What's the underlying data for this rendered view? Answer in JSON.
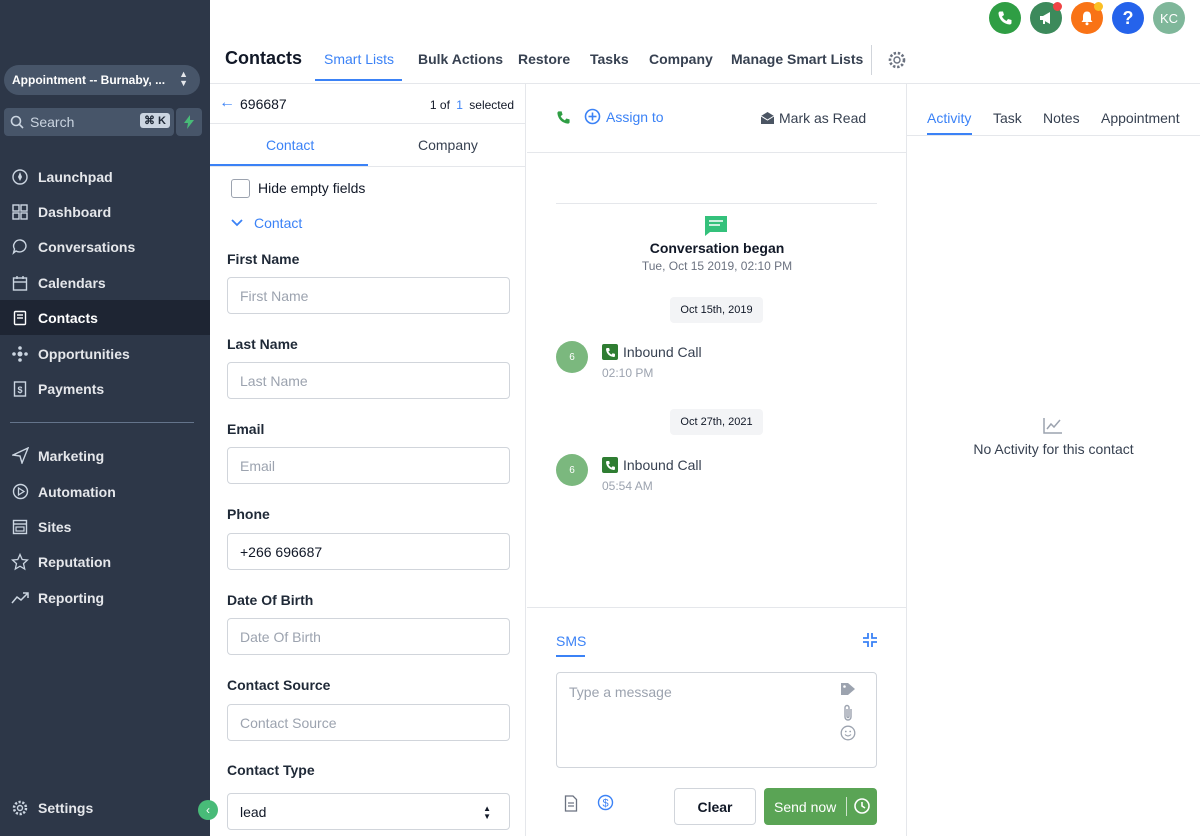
{
  "sidebar": {
    "location": "Appointment -- Burnaby, ...",
    "search_placeholder": "Search",
    "search_shortcut": "⌘ K",
    "items": [
      {
        "label": "Launchpad",
        "icon": "rocket-icon"
      },
      {
        "label": "Dashboard",
        "icon": "grid-icon"
      },
      {
        "label": "Conversations",
        "icon": "chat-icon"
      },
      {
        "label": "Calendars",
        "icon": "calendar-icon"
      },
      {
        "label": "Contacts",
        "icon": "contacts-icon",
        "active": true
      },
      {
        "label": "Opportunities",
        "icon": "opportunities-icon"
      },
      {
        "label": "Payments",
        "icon": "payments-icon"
      },
      {
        "label": "Marketing",
        "icon": "send-icon"
      },
      {
        "label": "Automation",
        "icon": "automation-icon"
      },
      {
        "label": "Sites",
        "icon": "sites-icon"
      },
      {
        "label": "Reputation",
        "icon": "star-icon"
      },
      {
        "label": "Reporting",
        "icon": "trend-icon"
      }
    ],
    "settings_label": "Settings"
  },
  "topbar": {
    "title": "Contacts",
    "tabs": [
      "Smart Lists",
      "Bulk Actions",
      "Restore",
      "Tasks",
      "Company",
      "Manage Smart Lists"
    ],
    "avatar_initials": "KC",
    "help_label": "?"
  },
  "contact": {
    "id": "696687",
    "pager_prefix": "1 of",
    "pager_count": "1",
    "pager_suffix": "selected",
    "tabs": [
      "Contact",
      "Company"
    ],
    "hide_empty_label": "Hide empty fields",
    "section_label": "Contact",
    "fields": [
      {
        "label": "First Name",
        "placeholder": "First Name",
        "value": ""
      },
      {
        "label": "Last Name",
        "placeholder": "Last Name",
        "value": ""
      },
      {
        "label": "Email",
        "placeholder": "Email",
        "value": ""
      },
      {
        "label": "Phone",
        "placeholder": "",
        "value": "+266 696687"
      },
      {
        "label": "Date Of Birth",
        "placeholder": "Date Of Birth",
        "value": ""
      },
      {
        "label": "Contact Source",
        "placeholder": "Contact Source",
        "value": ""
      },
      {
        "label": "Contact Type",
        "value": "lead"
      }
    ]
  },
  "conversation": {
    "assign_label": "Assign to",
    "mark_read_label": "Mark as Read",
    "began_label": "Conversation began",
    "began_time": "Tue, Oct 15 2019, 02:10 PM",
    "events": [
      {
        "date": "Oct 15th, 2019",
        "avatar": "6",
        "type": "Inbound Call",
        "time": "02:10 PM"
      },
      {
        "date": "Oct 27th, 2021",
        "avatar": "6",
        "type": "Inbound Call",
        "time": "05:54 AM"
      }
    ],
    "channel": "SMS",
    "message_placeholder": "Type a message",
    "clear_label": "Clear",
    "send_label": "Send now"
  },
  "activity": {
    "tabs": [
      "Activity",
      "Task",
      "Notes",
      "Appointment"
    ],
    "empty_text": "No Activity for this contact"
  },
  "colors": {
    "sidebar_bg": "#2d3748",
    "accent": "#3b82f6",
    "send_green": "#5aa455",
    "phone_green": "#2f9e44",
    "bell_orange": "#f97316"
  }
}
